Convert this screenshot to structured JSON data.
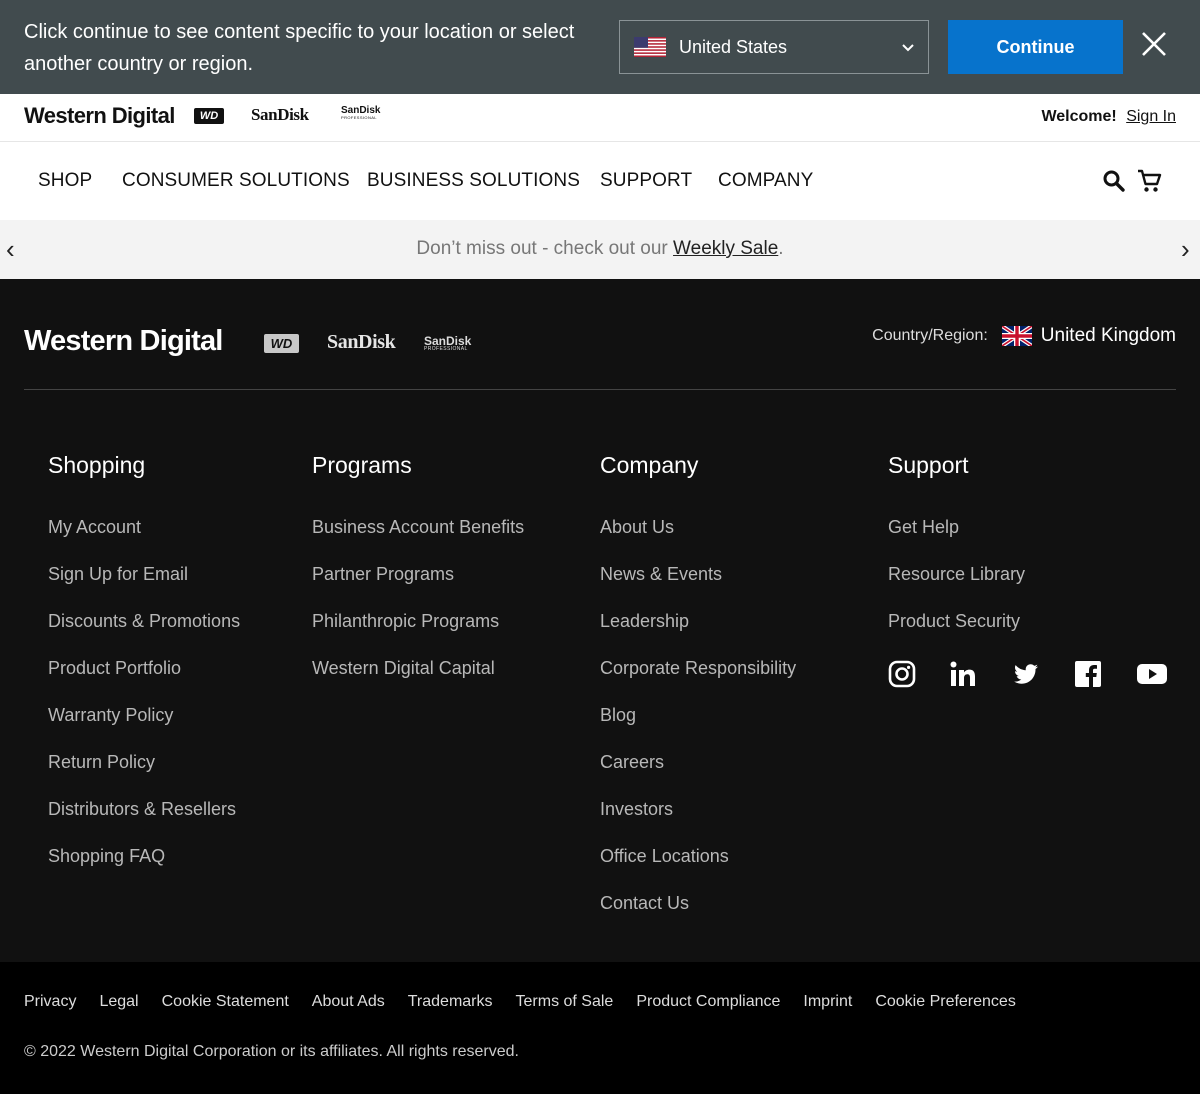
{
  "geo_banner": {
    "message": "Click continue to see content specific to your location or select another country or region.",
    "selected_country": "United States",
    "continue_label": "Continue"
  },
  "brand_bar": {
    "brands": [
      "Western Digital",
      "WD",
      "SanDisk",
      "SanDisk",
      "PROFESSIONAL"
    ],
    "welcome_label": "Welcome!",
    "sign_in_label": "Sign In"
  },
  "main_nav": {
    "items": [
      "SHOP",
      "CONSUMER SOLUTIONS",
      "BUSINESS SOLUTIONS",
      "SUPPORT",
      "COMPANY"
    ],
    "icons": [
      "search-icon",
      "cart-icon"
    ]
  },
  "promo": {
    "prefix": "Don’t miss out - check out our ",
    "link": "Weekly Sale",
    "suffix": ".",
    "prev": "‹",
    "next": "›"
  },
  "footer": {
    "region_label": "Country/Region:",
    "region_value": "United Kingdom",
    "columns": [
      {
        "title": "Shopping",
        "links": [
          "My Account",
          "Sign Up for Email",
          "Discounts & Promotions",
          "Product Portfolio",
          "Warranty Policy",
          "Return Policy",
          "Distributors & Resellers",
          "Shopping FAQ"
        ]
      },
      {
        "title": "Programs",
        "links": [
          "Business Account Benefits",
          "Partner Programs",
          "Philanthropic Programs",
          "Western Digital Capital"
        ]
      },
      {
        "title": "Company",
        "links": [
          "About Us",
          "News & Events",
          "Leadership",
          "Corporate Responsibility",
          "Blog",
          "Careers",
          "Investors",
          "Office Locations",
          "Contact Us"
        ]
      },
      {
        "title": "Support",
        "links": [
          "Get Help",
          "Resource Library",
          "Product Security"
        ]
      }
    ],
    "social_icons": [
      "instagram-icon",
      "linkedin-icon",
      "twitter-icon",
      "facebook-icon",
      "youtube-icon"
    ]
  },
  "legal": {
    "links": [
      "Privacy",
      "Legal",
      "Cookie Statement",
      "About Ads",
      "Trademarks",
      "Terms of Sale",
      "Product Compliance",
      "Imprint",
      "Cookie Preferences"
    ],
    "copyright": "© 2022 Western Digital Corporation or its affiliates. All rights reserved."
  },
  "colors": {
    "banner_bg": "#414b4e",
    "continue_bg": "#0773cc",
    "footer_bg": "#111111",
    "legal_bg": "#000000",
    "promo_bg": "#f3f3f3"
  }
}
